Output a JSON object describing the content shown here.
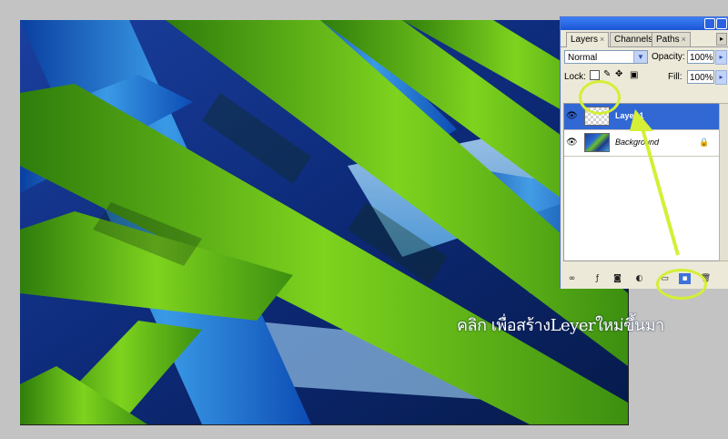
{
  "palette": {
    "tabs": [
      {
        "label": "Layers"
      },
      {
        "label": "Channels"
      },
      {
        "label": "Paths"
      }
    ],
    "blend_mode": "Normal",
    "opacity_label": "Opacity:",
    "opacity_value": "100%",
    "lock_label": "Lock:",
    "fill_label": "Fill:",
    "fill_value": "100%",
    "layers": [
      {
        "name": "Layer 1",
        "selected": true,
        "visible": true,
        "thumbnail": "transparent"
      },
      {
        "name": "Background",
        "selected": false,
        "visible": true,
        "thumbnail": "image",
        "locked": true
      }
    ],
    "bottom_buttons": [
      "link-icon",
      "layer-style-icon",
      "mask-icon",
      "adjustment-icon",
      "group-folder-icon",
      "new-layer-icon",
      "trash-icon"
    ]
  },
  "annotation": {
    "text": "คลิก เพื่อสร้างLeyerใหม่ขึ้นมา",
    "color": "#d4ef36"
  },
  "colors": {
    "selection": "#3168d4",
    "titlebar": "#1a55d6"
  }
}
